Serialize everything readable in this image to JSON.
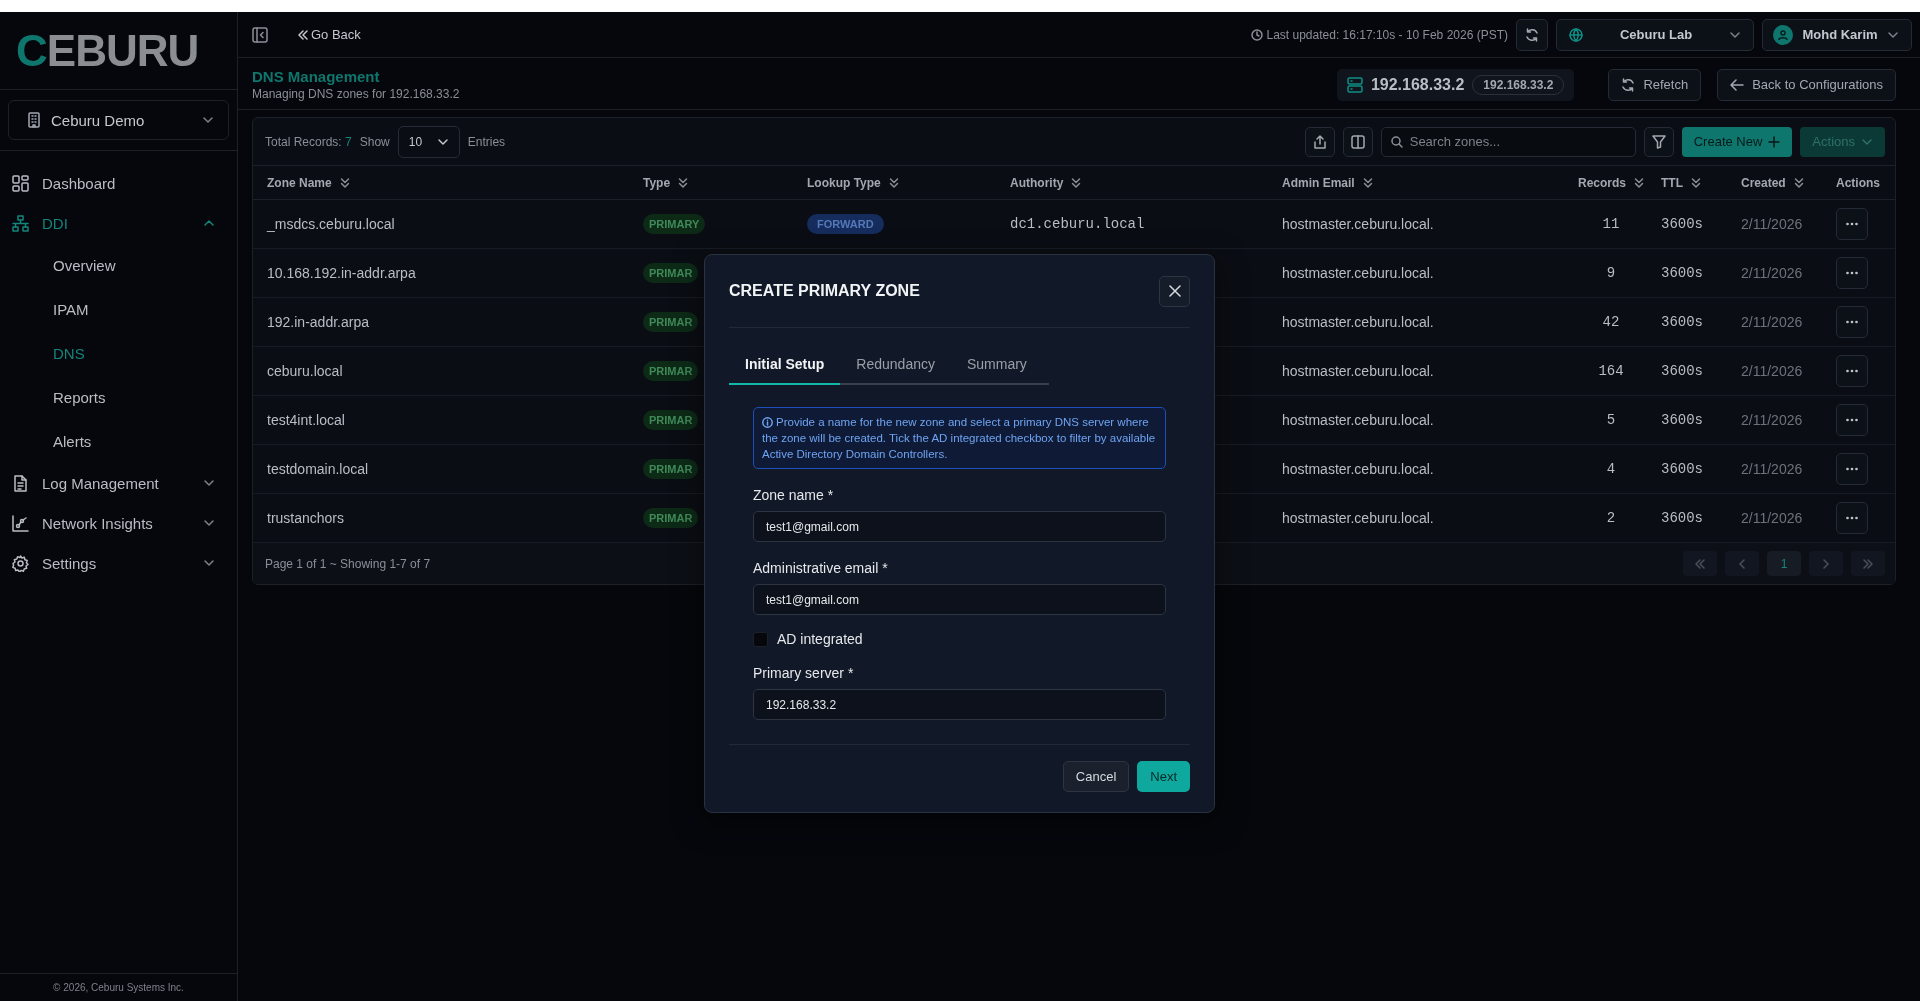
{
  "sidebar": {
    "logo": "CEBURU",
    "org_selector": "Ceburu Demo",
    "nav": [
      {
        "label": "Dashboard",
        "selected": false
      },
      {
        "label": "DDI",
        "selected": true,
        "expanded": true,
        "children": [
          {
            "label": "Overview",
            "selected": false
          },
          {
            "label": "IPAM",
            "selected": false
          },
          {
            "label": "DNS",
            "selected": true
          },
          {
            "label": "Reports",
            "selected": false
          },
          {
            "label": "Alerts",
            "selected": false
          }
        ]
      },
      {
        "label": "Log Management",
        "selected": false,
        "expanded": false
      },
      {
        "label": "Network Insights",
        "selected": false,
        "expanded": false
      },
      {
        "label": "Settings",
        "selected": false,
        "expanded": false
      }
    ],
    "footer": "© 2026, Ceburu Systems Inc."
  },
  "top_bar": {
    "go_back": "Go Back",
    "last_updated": "Last updated: 16:17:10s - 10 Feb 2026 (PST)",
    "site_selector": "Ceburu Lab",
    "user_menu": "Mohd Karim"
  },
  "header": {
    "title": "DNS Management",
    "subtitle": "Managing DNS zones for 192.168.33.2",
    "server": {
      "name": "192.168.33.2",
      "badge": "192.168.33.2"
    },
    "buttons": [
      "Refetch",
      "Back to Configurations"
    ]
  },
  "toolbar": {
    "total_label": "Total Records:",
    "total_count": "7",
    "show_label": "Show",
    "page_size": "10",
    "entries_label": "Entries",
    "search": {
      "placeholder": "Search zones..."
    },
    "create_button": "Create New",
    "actions_button": "Actions"
  },
  "table": {
    "columns": [
      {
        "label": "Zone Name",
        "sortable": true
      },
      {
        "label": "Type",
        "sortable": true
      },
      {
        "label": "Lookup Type",
        "sortable": true
      },
      {
        "label": "Authority",
        "sortable": true
      },
      {
        "label": "Admin Email",
        "sortable": true
      },
      {
        "label": "Records",
        "sortable": true
      },
      {
        "label": "TTL",
        "sortable": true
      },
      {
        "label": "Created",
        "sortable": true
      },
      {
        "label": "Actions",
        "sortable": false
      }
    ],
    "rows": [
      {
        "zone": "_msdcs.ceburu.local",
        "type": "PRIMARY",
        "lookup": "FORWARD",
        "authority": "dc1.ceburu.local",
        "admin_email": "hostmaster.ceburu.local.",
        "records": "11",
        "ttl": "3600s",
        "created": "2/11/2026"
      },
      {
        "zone": "10.168.192.in-addr.arpa",
        "type": "PRIMAR",
        "admin_email": "hostmaster.ceburu.local.",
        "records": "9",
        "ttl": "3600s",
        "created": "2/11/2026"
      },
      {
        "zone": "192.in-addr.arpa",
        "type": "PRIMAR",
        "admin_email": "hostmaster.ceburu.local.",
        "records": "42",
        "ttl": "3600s",
        "created": "2/11/2026"
      },
      {
        "zone": "ceburu.local",
        "type": "PRIMAR",
        "admin_email": "hostmaster.ceburu.local.",
        "records": "164",
        "ttl": "3600s",
        "created": "2/11/2026"
      },
      {
        "zone": "test4int.local",
        "type": "PRIMAR",
        "admin_email": "hostmaster.ceburu.local.",
        "records": "5",
        "ttl": "3600s",
        "created": "2/11/2026"
      },
      {
        "zone": "testdomain.local",
        "type": "PRIMAR",
        "admin_email": "hostmaster.ceburu.local.",
        "records": "4",
        "ttl": "3600s",
        "created": "2/11/2026"
      },
      {
        "zone": "trustanchors",
        "type": "PRIMAR",
        "admin_email": "hostmaster.ceburu.local.",
        "records": "2",
        "ttl": "3600s",
        "created": "2/11/2026"
      }
    ]
  },
  "pagination": {
    "summary": "Page 1 of 1 ~ Showing 1-7 of 7",
    "pages": [
      {
        "label": "1",
        "selected": true
      }
    ]
  },
  "modal": {
    "title": "CREATE PRIMARY ZONE",
    "tabs": [
      {
        "label": "Initial Setup",
        "selected": true
      },
      {
        "label": "Redundancy",
        "selected": false
      },
      {
        "label": "Summary",
        "selected": false
      }
    ],
    "info": "Provide a name for the new zone and select a primary DNS server where the zone will be created. Tick the AD integrated checkbox to filter by available Active Directory Domain Controllers.",
    "fields": [
      {
        "kind": "text",
        "label": "Zone name *",
        "value": "test1@gmail.com"
      },
      {
        "kind": "text",
        "label": "Administrative email *",
        "value": "test1@gmail.com"
      },
      {
        "kind": "checkbox",
        "label": "AD integrated",
        "checked": false
      },
      {
        "kind": "text",
        "label": "Primary server *",
        "value": "192.168.33.2"
      }
    ],
    "buttons": [
      {
        "label": "Cancel",
        "kind": "secondary"
      },
      {
        "label": "Next",
        "kind": "primary"
      }
    ]
  }
}
